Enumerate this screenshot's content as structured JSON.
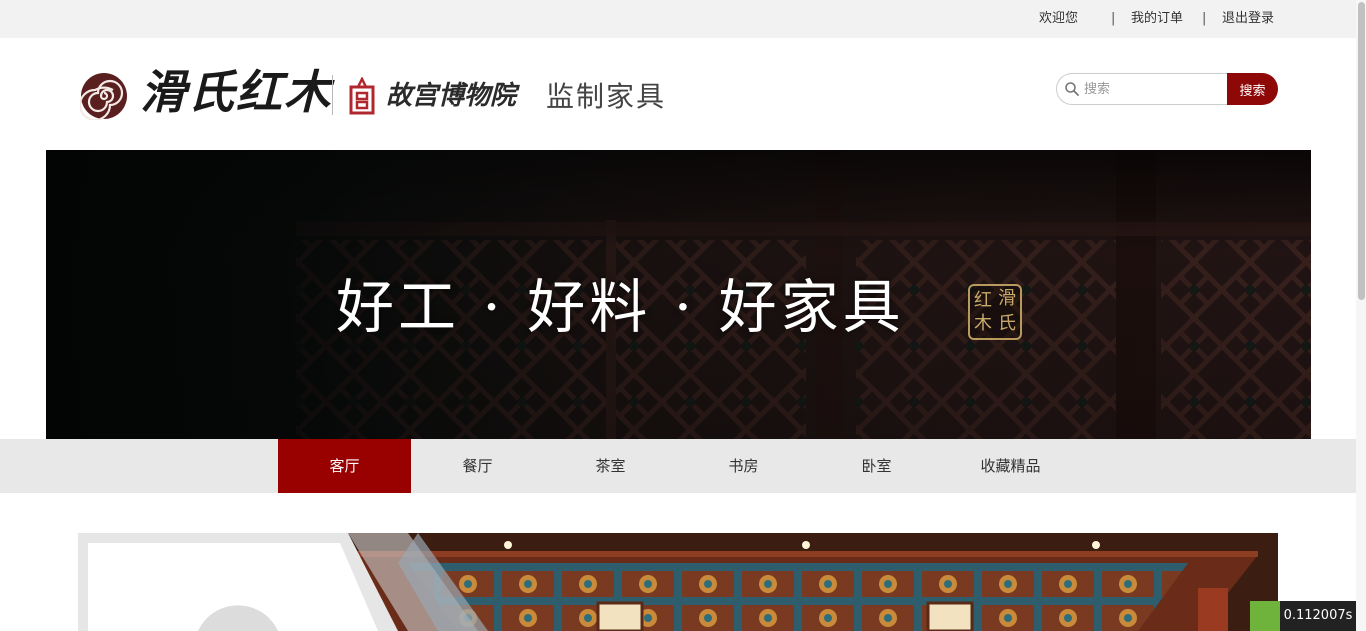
{
  "topbar": {
    "welcome": "欢迎您",
    "separator": "|",
    "my_orders": "我的订单",
    "logout": "退出登录"
  },
  "header": {
    "brand": "滑氏红木",
    "museum": "故宫博物院",
    "supervise": "监制家具",
    "logo_icon": "spiral-logo-icon",
    "museum_icon": "palace-museum-icon"
  },
  "search": {
    "placeholder": "搜索",
    "button": "搜索",
    "icon": "search-icon"
  },
  "banner": {
    "slogan": "好工 · 好料 · 好家具",
    "seal_chars": [
      "红",
      "滑",
      "木",
      "氏"
    ]
  },
  "nav": {
    "items": [
      {
        "label": "客厅",
        "active": true
      },
      {
        "label": "餐厅",
        "active": false
      },
      {
        "label": "茶室",
        "active": false
      },
      {
        "label": "书房",
        "active": false
      },
      {
        "label": "卧室",
        "active": false
      },
      {
        "label": "收藏精品",
        "active": false
      }
    ]
  },
  "perf_timer": "0.112007s",
  "colors": {
    "accent": "#990000",
    "search_button": "#8e0808",
    "topbar_bg": "#f2f2f2",
    "nav_bg": "#e8e8e8"
  }
}
